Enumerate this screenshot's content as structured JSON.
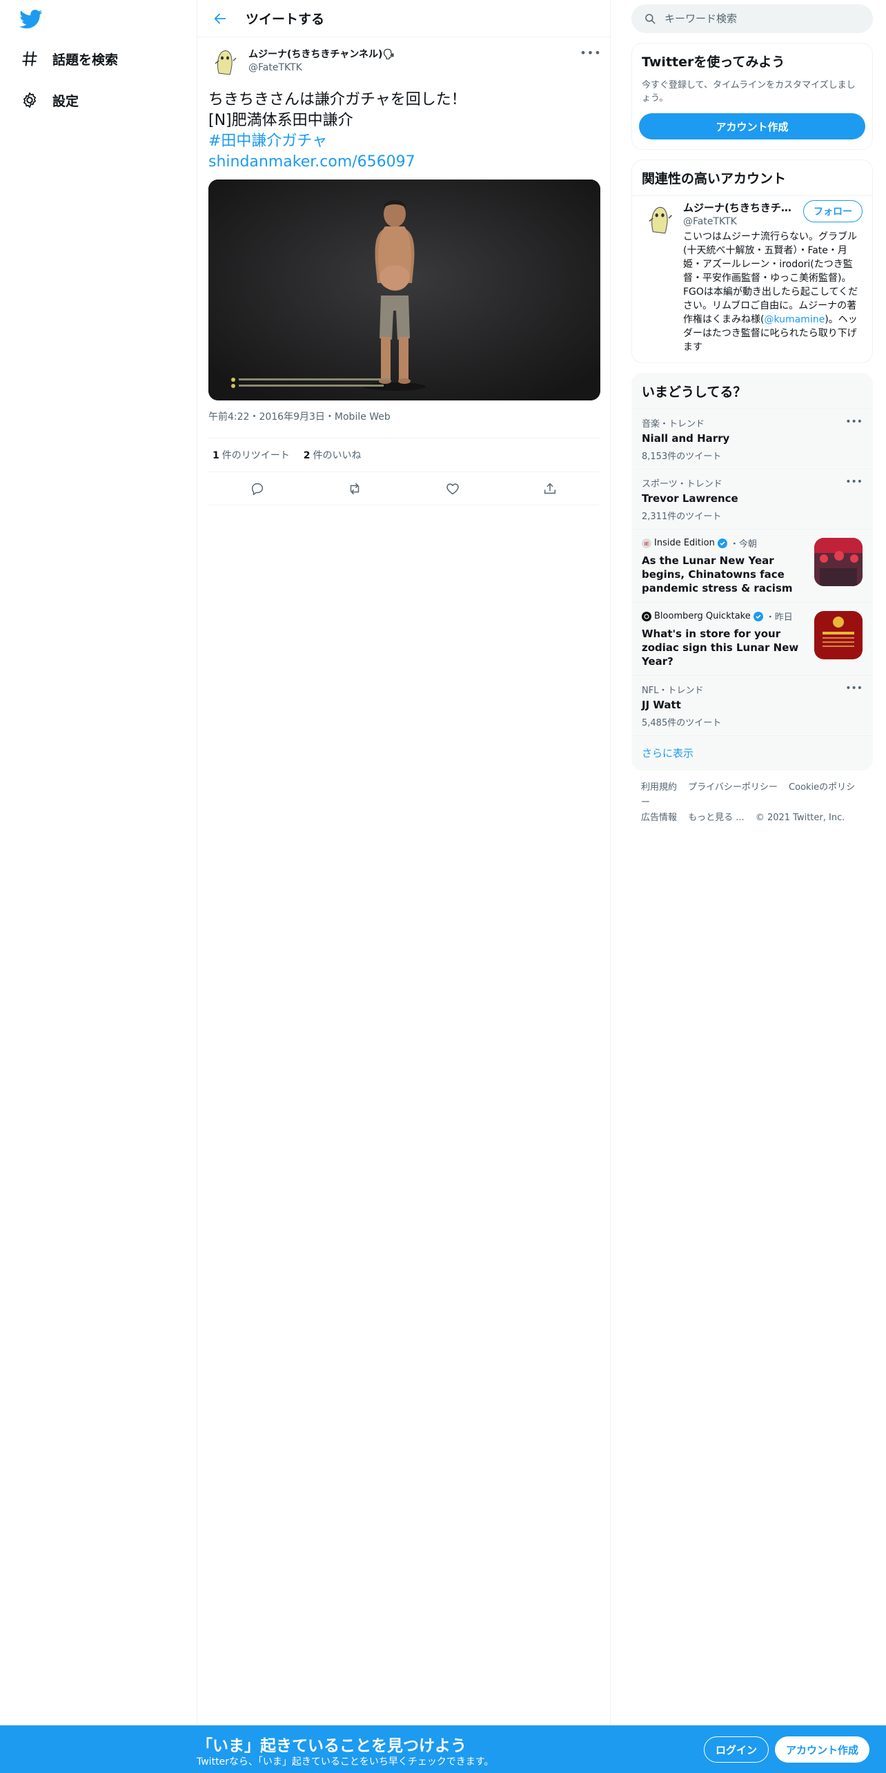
{
  "colors": {
    "brand": "#1d9bf0",
    "text": "#0f1419",
    "muted": "#536471",
    "border": "#eff3f4"
  },
  "nav": {
    "logo_icon": "twitter-bird-icon",
    "items": [
      {
        "label": "話題を検索",
        "icon": "hashtag-icon"
      },
      {
        "label": "設定",
        "icon": "gear-icon"
      }
    ]
  },
  "header": {
    "title": "ツイートする",
    "back_icon": "arrow-left-icon"
  },
  "tweet": {
    "author_name": "ムジーナ(ちきちきチャンネル)🗣",
    "author_handle": "@FateTKTK",
    "lines": [
      "ちきちきさんは謙介ガチャを回した！",
      "[N]肥満体系田中謙介"
    ],
    "hashtag": "#田中謙介ガチャ",
    "link": "shindanmaker.com/656097",
    "time": "午前4:22",
    "date": "2016年9月3日",
    "source": "Mobile Web",
    "retweets_count": "1",
    "retweets_label": "件のリツイート",
    "likes_count": "2",
    "likes_label": "件のいいね"
  },
  "search": {
    "placeholder": "キーワード検索"
  },
  "signup_card": {
    "title": "Twitterを使ってみよう",
    "desc": "今すぐ登録して、タイムラインをカスタマイズしましょう。",
    "button": "アカウント作成"
  },
  "related": {
    "title": "関連性の高いアカウント",
    "name": "ムジーナ(ちきちきチ...",
    "handle": "@FateTKTK",
    "follow": "フォロー",
    "bio_1": "こいつはムジーナ流行らない。グラブル(十天統べ十解放・五賢者）・Fate・月姫・アズールレーン・irodori(たつき監督・平安作画監督・ゆっこ美術監督)。FGOは本編が動き出したら起こしてください。リムブロご自由に。ムジーナの著作権はくまみね様(",
    "bio_mention": "@kumamine",
    "bio_2": ")。ヘッダーはたつき監督に叱られたら取り下げます"
  },
  "trends": {
    "title": "いまどうしてる？",
    "items": [
      {
        "context": "音楽・トレンド",
        "name": "Niall and Harry",
        "count": "8,153件のツイート"
      },
      {
        "context": "スポーツ・トレンド",
        "name": "Trevor Lawrence",
        "count": "2,311件のツイート"
      }
    ],
    "news": [
      {
        "source": "Inside Edition",
        "time": "・今朝",
        "headline": "As the Lunar New Year begins, Chinatowns face pandemic stress & racism"
      },
      {
        "source": "Bloomberg Quicktake",
        "time": "・昨日",
        "headline": "What's in store for your zodiac sign this Lunar New Year?"
      }
    ],
    "last": {
      "context": "NFL・トレンド",
      "name": "JJ Watt",
      "count": "5,485件のツイート"
    },
    "show_more": "さらに表示"
  },
  "footer": {
    "links": [
      "利用規約",
      "プライバシーポリシー",
      "Cookieのポリシー",
      "広告情報",
      "もっと見る ..."
    ],
    "copyright": "© 2021 Twitter, Inc."
  },
  "bottom_bar": {
    "title": "「いま」起きていることを見つけよう",
    "subtitle": "Twitterなら、「いま」起きていることをいち早くチェックできます。",
    "login": "ログイン",
    "signup": "アカウント作成"
  }
}
